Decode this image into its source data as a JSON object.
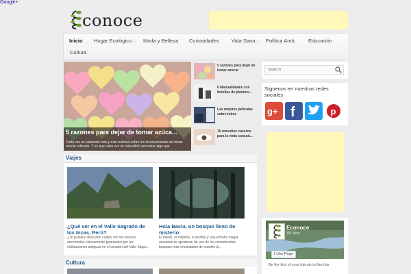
{
  "top_link": "Google+",
  "site": {
    "logo_text": "conoce"
  },
  "nav": {
    "items": [
      {
        "label": "Inicio",
        "active": true,
        "dropdown": false
      },
      {
        "label": "Hogar Ecológico",
        "active": false,
        "dropdown": true
      },
      {
        "label": "Moda y Belleza",
        "active": false,
        "dropdown": false
      },
      {
        "label": "Curiosidades",
        "active": false,
        "dropdown": false
      },
      {
        "label": "Vida Sana",
        "active": false,
        "dropdown": true
      },
      {
        "label": "Política Amb.",
        "active": false,
        "dropdown": false
      },
      {
        "label": "Educación",
        "active": false,
        "dropdown": false
      },
      {
        "label": "Cultura",
        "active": false,
        "dropdown": false
      }
    ]
  },
  "featured": {
    "title": "5 razones para dejar de tomar azúca...",
    "excerpt": "Cada vez es sabiendo más y más noticias sobre los inconvenientes de tomar azúcar refinado. Y es que cada vez es más difícil encontrar algo que"
  },
  "side_list": [
    {
      "title": "5 razones para dejar de tomar azúcar"
    },
    {
      "title": "6 Manualidades con botellas de plástico..."
    },
    {
      "title": "Las mejores películas sobre lobos"
    },
    {
      "title": "10 remedios caseros para la vista cansad..."
    }
  ],
  "sections": {
    "viajes": "Viajes",
    "cultura": "Cultura"
  },
  "viajes_cards": [
    {
      "title": "¿Qué ver en el Valle Sagrado de los Incas, Perú?",
      "excerpt": "¿Te gustaría descubrir cuáles son los tesoros ancestrales celosamente guardados por las civilizaciones antiguas en el corazón del Valle Sagra..."
    },
    {
      "title": "Hoia Baciu, un bosque lleno de misterio",
      "excerpt": "El miedo, el misterio, lo insólito y una extraña magia ancestral se apoderan de uno de los considerados bosques más encantados de nuestro pl..."
    }
  ],
  "sidebar": {
    "search_placeholder": "Search",
    "social_title": "Síguenos en nuestras redes sociales",
    "social_icons": [
      "google-plus-icon",
      "facebook-icon",
      "twitter-icon",
      "pinterest-icon"
    ],
    "facebook": {
      "page_name": "Econoce",
      "likes": "181 likes",
      "like_button": "Like Page",
      "friends_text": "Be the first of your friends to like this"
    }
  },
  "colors": {
    "accent": "#1e5a8a",
    "ad_yellow": "#fff8b8",
    "google_plus": "#dd4b39",
    "facebook": "#3b5998",
    "twitter": "#1da1f2",
    "pinterest": "#cb2027"
  }
}
